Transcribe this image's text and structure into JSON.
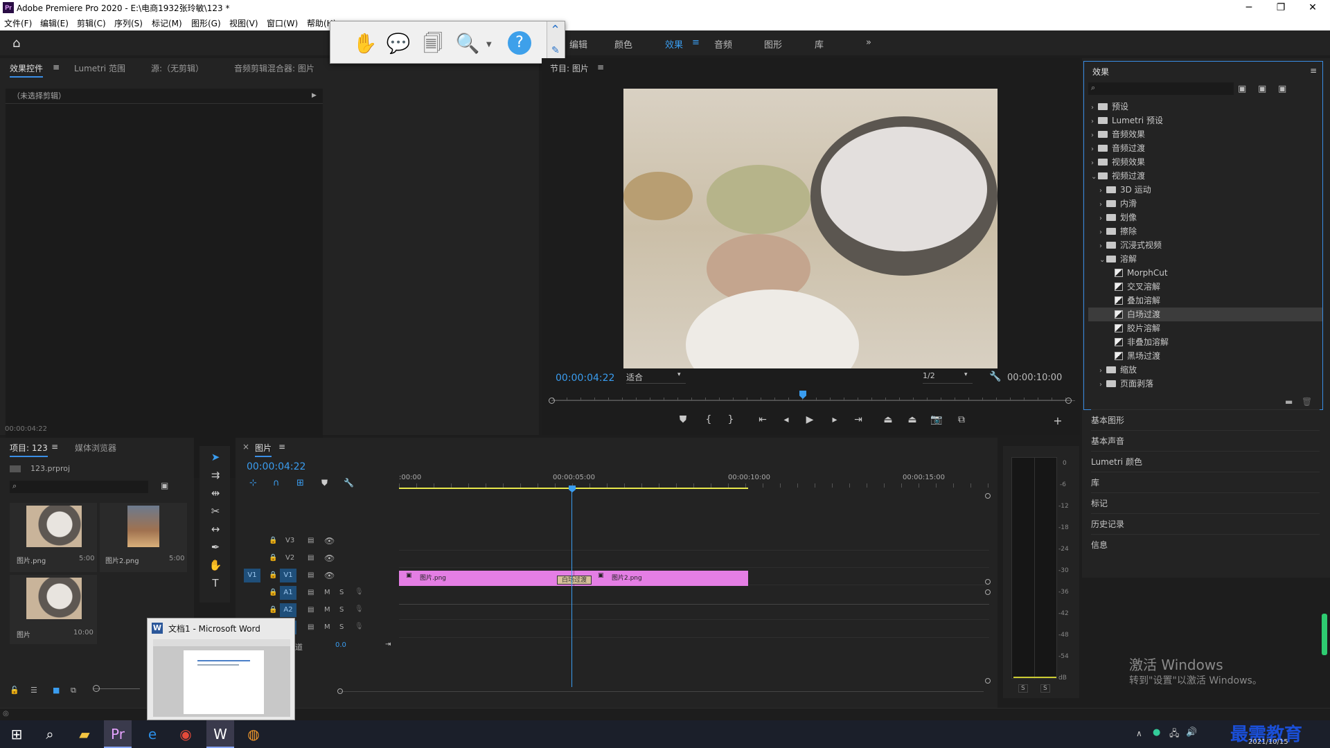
{
  "titlebar": {
    "logo": "Pr",
    "title": "Adobe Premiere Pro 2020 - E:\\电商1932张玲敏\\123 *",
    "min": "─",
    "max": "❐",
    "close": "✕"
  },
  "menu": [
    "文件(F)",
    "编辑(E)",
    "剪辑(C)",
    "序列(S)",
    "标记(M)",
    "图形(G)",
    "视图(V)",
    "窗口(W)",
    "帮助(H)"
  ],
  "workspace_tabs": [
    "编辑",
    "颜色",
    "效果",
    "音频",
    "图形",
    "库"
  ],
  "workspace_more": "»",
  "left_panel": {
    "tabs": [
      "效果控件",
      "Lumetri 范围",
      "源:（无剪辑）",
      "音频剪辑混合器: 图片"
    ],
    "no_clip": "（未选择剪辑）",
    "timecode": "00:00:04:22"
  },
  "program": {
    "title": "节目: 图片",
    "timecode": "00:00:04:22",
    "fit": "适合",
    "quality": "1/2",
    "duration": "00:00:10:00"
  },
  "effects": {
    "title": "效果",
    "tree": [
      {
        "label": "预设",
        "level": 0,
        "type": "folder",
        "open": false
      },
      {
        "label": "Lumetri 预设",
        "level": 0,
        "type": "folder",
        "open": false
      },
      {
        "label": "音频效果",
        "level": 0,
        "type": "folder",
        "open": false
      },
      {
        "label": "音频过渡",
        "level": 0,
        "type": "folder",
        "open": false
      },
      {
        "label": "视频效果",
        "level": 0,
        "type": "folder",
        "open": false
      },
      {
        "label": "视频过渡",
        "level": 0,
        "type": "folder",
        "open": true
      },
      {
        "label": "3D 运动",
        "level": 1,
        "type": "folder",
        "open": false
      },
      {
        "label": "内滑",
        "level": 1,
        "type": "folder",
        "open": false
      },
      {
        "label": "划像",
        "level": 1,
        "type": "folder",
        "open": false
      },
      {
        "label": "擦除",
        "level": 1,
        "type": "folder",
        "open": false
      },
      {
        "label": "沉浸式视频",
        "level": 1,
        "type": "folder",
        "open": false
      },
      {
        "label": "溶解",
        "level": 1,
        "type": "folder",
        "open": true
      },
      {
        "label": "MorphCut",
        "level": 2,
        "type": "fx"
      },
      {
        "label": "交叉溶解",
        "level": 2,
        "type": "fx"
      },
      {
        "label": "叠加溶解",
        "level": 2,
        "type": "fx"
      },
      {
        "label": "白场过渡",
        "level": 2,
        "type": "fx",
        "selected": true
      },
      {
        "label": "胶片溶解",
        "level": 2,
        "type": "fx"
      },
      {
        "label": "非叠加溶解",
        "level": 2,
        "type": "fx"
      },
      {
        "label": "黑场过渡",
        "level": 2,
        "type": "fx"
      },
      {
        "label": "缩放",
        "level": 1,
        "type": "folder",
        "open": false
      },
      {
        "label": "页面剥落",
        "level": 1,
        "type": "folder",
        "open": false
      }
    ]
  },
  "side_panels": [
    "基本图形",
    "基本声音",
    "Lumetri 颜色",
    "库",
    "标记",
    "历史记录",
    "信息"
  ],
  "project": {
    "tabs": [
      "项目: 123",
      "媒体浏览器"
    ],
    "file": "123.prproj",
    "items": [
      {
        "name": "图片.png",
        "dur": "5:00"
      },
      {
        "name": "图片2.png",
        "dur": "5:00"
      },
      {
        "name": "图片",
        "dur": "10:00"
      }
    ]
  },
  "timeline": {
    "tab": "图片",
    "timecode": "00:00:04:22",
    "ruler": [
      ":00:00",
      "00:00:05:00",
      "00:00:10:00",
      "00:00:15:00"
    ],
    "tracks": [
      "V3",
      "V2",
      "V1",
      "A1",
      "A2",
      "A3"
    ],
    "source_v1": "V1",
    "clip1": "图片.png",
    "clip2": "图片2.png",
    "transition": "白场过渡",
    "master_label": "主声道",
    "master_value": "0.0",
    "msb": [
      "M",
      "S"
    ]
  },
  "meter": {
    "scale": [
      "0",
      "-6",
      "-12",
      "-18",
      "-24",
      "-30",
      "-36",
      "-42",
      "-48",
      "-54",
      "dB"
    ],
    "solo": [
      "S",
      "S"
    ]
  },
  "word_popup": {
    "title": "文档1 - Microsoft Word",
    "icon": "W"
  },
  "watermark": {
    "line1": "激活 Windows",
    "line2": "转到\"设置\"以激活 Windows。"
  },
  "taskbar": {
    "date": "2021/10/15",
    "brand": "最需教育"
  },
  "colors": {
    "accent": "#3a8ee6",
    "clip": "#e47ee4",
    "bg": "#232323"
  }
}
